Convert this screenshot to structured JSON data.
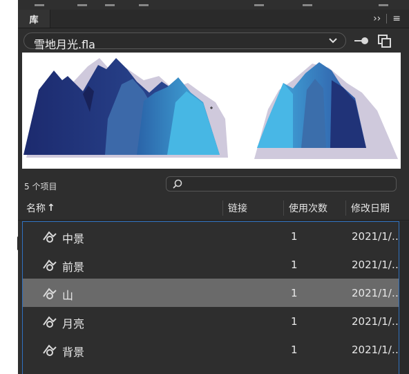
{
  "panel": {
    "tab_label": "库",
    "menu_overflow_glyph": "››",
    "menu_hamburger_glyph": "≡"
  },
  "document": {
    "selected_file": "雪地月光.fla"
  },
  "library": {
    "item_count_text": "5 个项目",
    "search_placeholder": ""
  },
  "columns": {
    "name": "名称",
    "sort_indicator": "↑",
    "linkage": "链接",
    "use_count": "使用次数",
    "modified": "修改日期"
  },
  "items": [
    {
      "name": "中景",
      "uses": "1",
      "date": "2021/1/…",
      "selected": false,
      "icon": "graphic-symbol-icon"
    },
    {
      "name": "前景",
      "uses": "1",
      "date": "2021/1/…",
      "selected": false,
      "icon": "graphic-symbol-icon"
    },
    {
      "name": "山",
      "uses": "1",
      "date": "2021/1/…",
      "selected": true,
      "icon": "graphic-symbol-icon"
    },
    {
      "name": "月亮",
      "uses": "1",
      "date": "2021/1/…",
      "selected": false,
      "icon": "graphic-symbol-icon"
    },
    {
      "name": "背景",
      "uses": "1",
      "date": "2021/1/…",
      "selected": false,
      "icon": "graphic-symbol-icon"
    }
  ],
  "colors": {
    "panel_bg": "#2e2e2e",
    "selected_row": "#6a6a6a",
    "focus_outline": "#2f72c2",
    "preview_bg": "#ffffff"
  }
}
